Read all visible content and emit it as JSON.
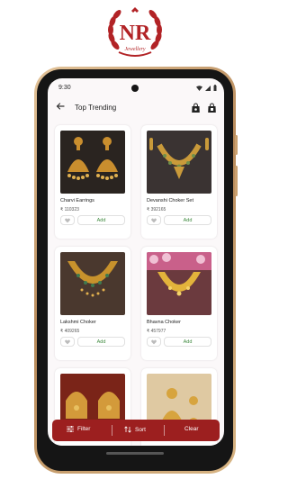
{
  "brand": {
    "initials": "NR",
    "tagline": "Jewellery",
    "color": "#b22326"
  },
  "status_bar": {
    "time": "9:30"
  },
  "app_bar": {
    "title": "Top Trending",
    "back_icon": "arrow-left-icon",
    "icons": [
      "shopping-bag-icon",
      "shopping-bag-icon"
    ]
  },
  "products": [
    {
      "name": "Charvi Earrings",
      "price": "₹ 110323",
      "add_label": "Add"
    },
    {
      "name": "Devanshi Choker Set",
      "price": "₹ 392165",
      "add_label": "Add"
    },
    {
      "name": "Lakshmi Choker",
      "price": "₹ 409265",
      "add_label": "Add"
    },
    {
      "name": "Bhavna Choker",
      "price": "₹ 457977",
      "add_label": "Add"
    }
  ],
  "bottom_bar": {
    "color": "#9c1f1f",
    "filter_label": "Filter",
    "sort_label": "Sort",
    "clear_label": "Clear"
  }
}
